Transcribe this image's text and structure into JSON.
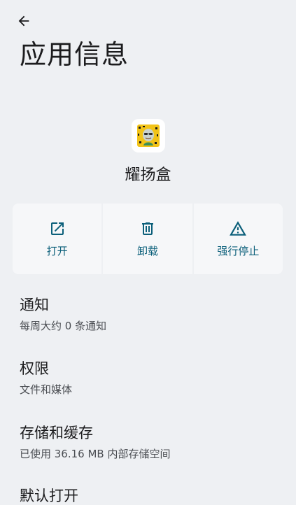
{
  "header": {
    "title": "应用信息"
  },
  "app": {
    "name": "耀扬盒"
  },
  "actions": [
    {
      "label": "打开",
      "icon": "open-external-icon"
    },
    {
      "label": "卸载",
      "icon": "trash-icon"
    },
    {
      "label": "强行停止",
      "icon": "warning-icon"
    }
  ],
  "preferences": [
    {
      "title": "通知",
      "summary": "每周大约 0 条通知"
    },
    {
      "title": "权限",
      "summary": "文件和媒体"
    },
    {
      "title": "存储和缓存",
      "summary": "已使用 36.16 MB 内部存储空间"
    },
    {
      "title": "默认打开"
    }
  ],
  "colors": {
    "accent": "#0b5f7a",
    "background": "#eef0f3",
    "card": "#f6f7f9"
  }
}
